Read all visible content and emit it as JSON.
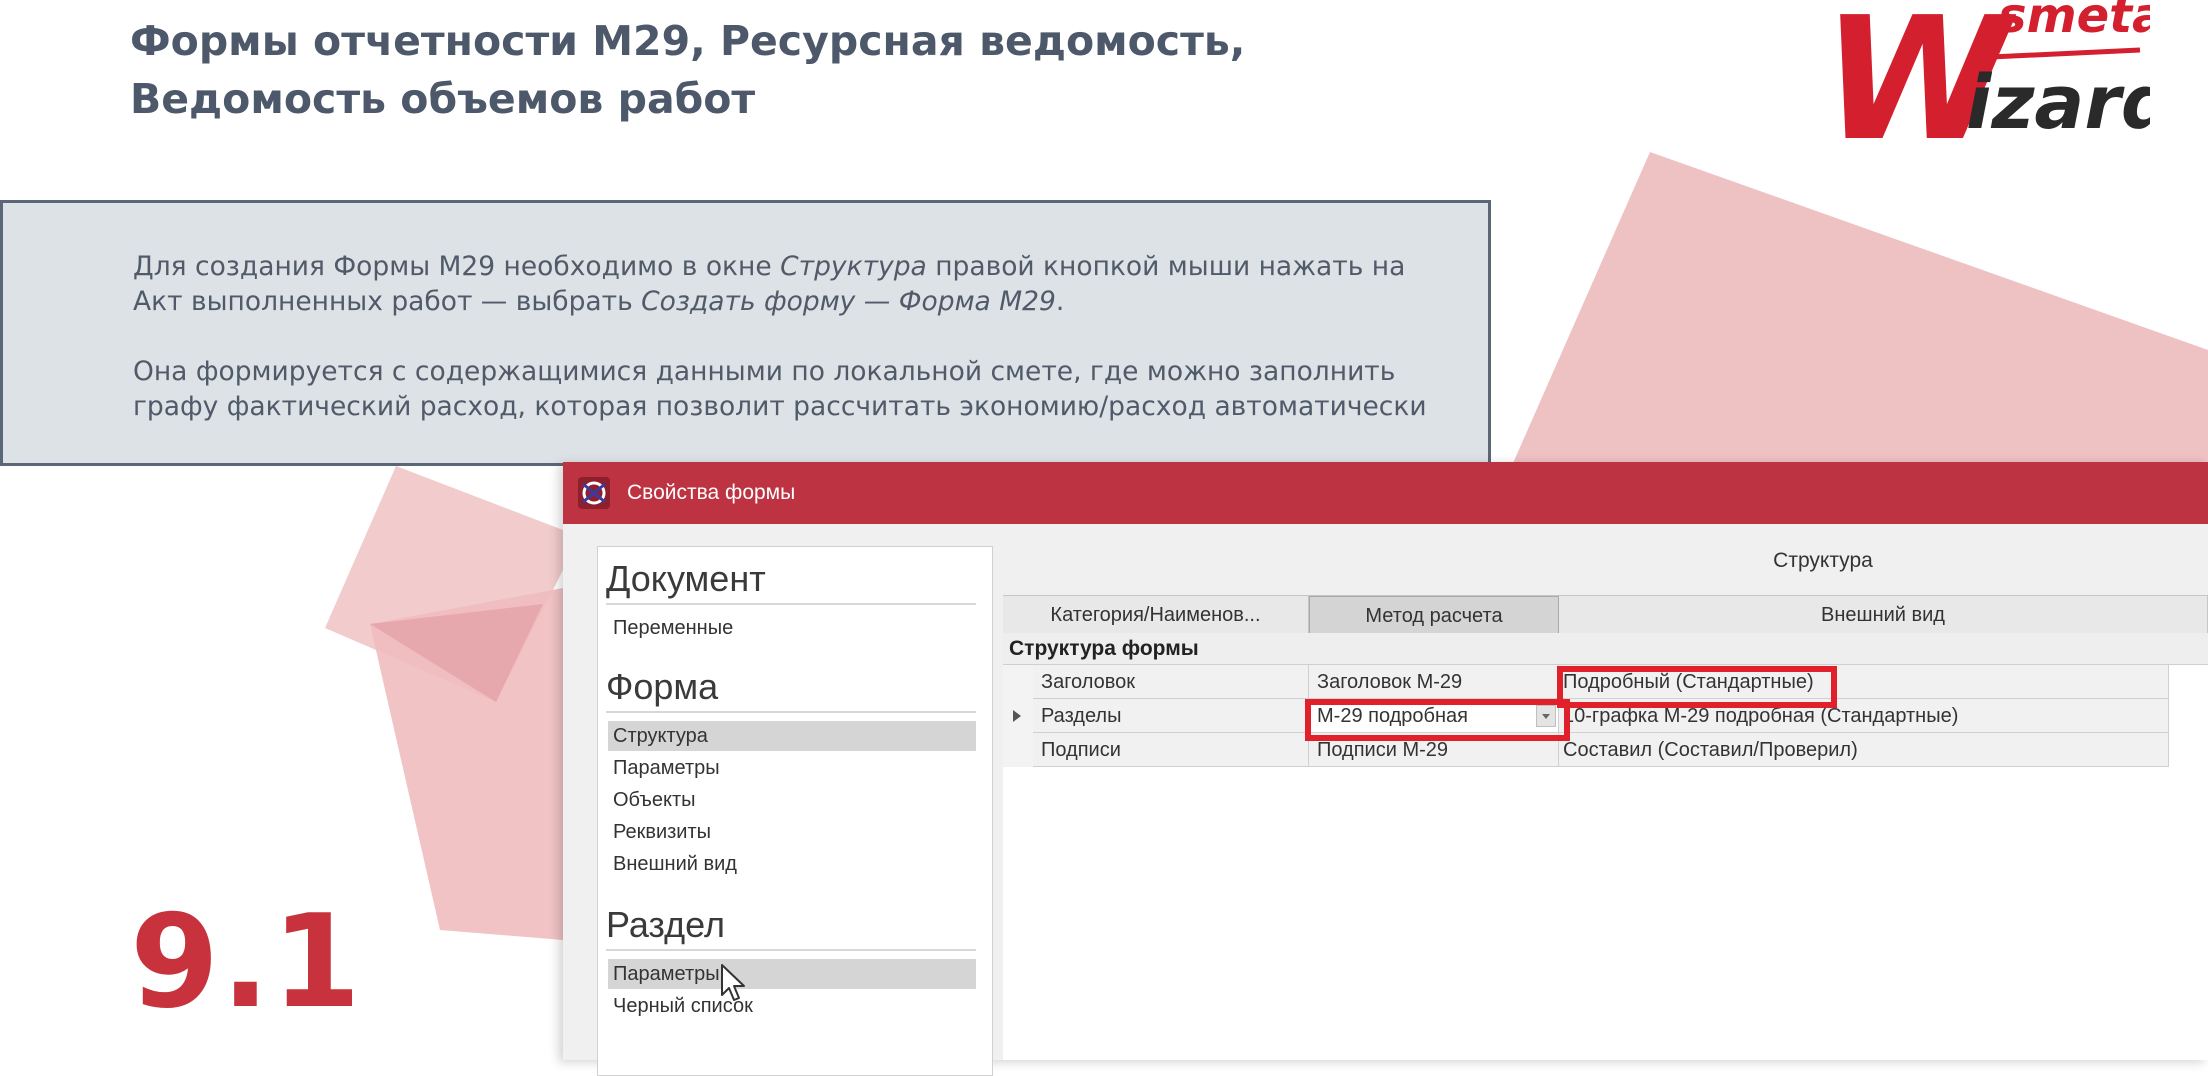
{
  "slide": {
    "title_line1": "Формы отчетности М29, Ресурсная ведомость,",
    "title_line2": "Ведомость объемов работ",
    "number": "9.1"
  },
  "logo": {
    "word_top": "smeta",
    "word_bottom": "izard",
    "letter": "W",
    "color_red": "#d41f2e",
    "color_dark": "#2a2a2a"
  },
  "info": {
    "p1_a": "Для создания Формы М29 необходимо в окне ",
    "p1_b": "Структура",
    "p1_c": " правой кнопкой мыши нажать на",
    "p1_d": "Акт выполненных работ — выбрать ",
    "p1_e": "Создать форму — Форма М29",
    "p1_f": ".",
    "p2_line1": "Она формируется с содержащимися данными по локальной смете, где можно заполнить",
    "p2_line2": "графу фактический расход, которая позволит рассчитать экономию/расход автоматически"
  },
  "window": {
    "title": "Свойства формы",
    "accent": "#bd3341",
    "nav": {
      "document_header": "Документ",
      "document_items": [
        "Переменные"
      ],
      "form_header": "Форма",
      "form_items": [
        "Структура",
        "Параметры",
        "Объекты",
        "Реквизиты",
        "Внешний вид"
      ],
      "section_header": "Раздел",
      "section_items": [
        "Параметры",
        "Черный список"
      ]
    },
    "content_title": "Структура",
    "tabs": [
      "Категория/Наименов...",
      "Метод расчета",
      "Внешний вид"
    ],
    "active_tab": "Метод расчета",
    "group_label": "Структура формы",
    "rows": [
      {
        "name": "Заголовок",
        "method": "Заголовок М-29",
        "view": "Подробный (Стандартные)"
      },
      {
        "name": "Разделы",
        "method": "М-29 подробная",
        "view": "10-графка М-29 подробная (Стандартные)"
      },
      {
        "name": "Подписи",
        "method": "Подписи М-29",
        "view": "Составил (Составил/Проверил)"
      }
    ],
    "highlight_color": "#e0202a"
  },
  "icons": [
    "window-app-icon",
    "row-pointer-icon",
    "dropdown-arrow-icon",
    "mouse-cursor-icon"
  ]
}
